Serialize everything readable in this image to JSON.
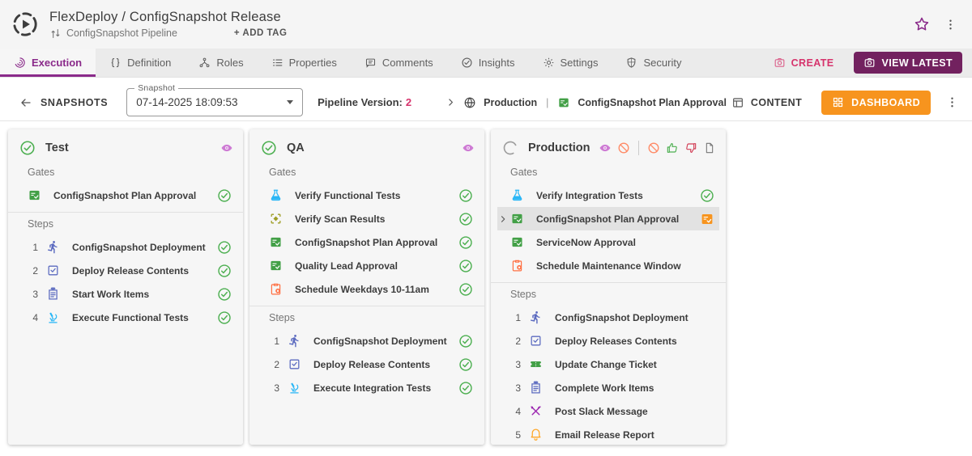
{
  "header": {
    "title": "FlexDeploy / ConfigSnapshot Release",
    "pipeline_label": "ConfigSnapshot Pipeline",
    "add_tag_label": "+ ADD TAG"
  },
  "tabs": [
    {
      "label": "Execution",
      "icon": "execution",
      "active": true
    },
    {
      "label": "Definition",
      "icon": "braces",
      "active": false
    },
    {
      "label": "Roles",
      "icon": "roles",
      "active": false
    },
    {
      "label": "Properties",
      "icon": "properties",
      "active": false
    },
    {
      "label": "Comments",
      "icon": "comments",
      "active": false
    },
    {
      "label": "Insights",
      "icon": "insights",
      "active": false
    },
    {
      "label": "Settings",
      "icon": "gear",
      "active": false
    },
    {
      "label": "Security",
      "icon": "shield",
      "active": false
    }
  ],
  "actions": {
    "create_label": "CREATE",
    "view_latest_label": "VIEW LATEST"
  },
  "snapshot_bar": {
    "back_label": "SNAPSHOTS",
    "select_label": "Snapshot",
    "select_value": "07-14-2025 18:09:53",
    "pipeline_version_label": "Pipeline Version:",
    "pipeline_version_value": "2",
    "env_name": "Production",
    "separator": "|",
    "gate_name": "ConfigSnapshot Plan Approval",
    "content_label": "CONTENT",
    "dashboard_label": "DASHBOARD"
  },
  "section_labels": {
    "gates": "Gates",
    "steps": "Steps"
  },
  "columns": [
    {
      "name": "Test",
      "status": "success",
      "header_icons": [
        "eye"
      ],
      "gates": [
        {
          "icon": "approval",
          "label": "ConfigSnapshot Plan Approval",
          "status": "success"
        }
      ],
      "steps": [
        {
          "num": "1",
          "icon": "run",
          "label": "ConfigSnapshot Deployment",
          "status": "success"
        },
        {
          "num": "2",
          "icon": "deploy",
          "label": "Deploy Release Contents",
          "status": "success"
        },
        {
          "num": "3",
          "icon": "workitem",
          "label": "Start Work Items",
          "status": "success"
        },
        {
          "num": "4",
          "icon": "microscope",
          "label": "Execute Functional Tests",
          "status": "success"
        }
      ]
    },
    {
      "name": "QA",
      "status": "success",
      "header_icons": [
        "eye"
      ],
      "gates": [
        {
          "icon": "flask",
          "label": "Verify Functional Tests",
          "status": "success"
        },
        {
          "icon": "scan",
          "label": "Verify Scan Results",
          "status": "success"
        },
        {
          "icon": "approval",
          "label": "ConfigSnapshot Plan Approval",
          "status": "success"
        },
        {
          "icon": "approval",
          "label": "Quality Lead Approval",
          "status": "success"
        },
        {
          "icon": "schedule",
          "label": "Schedule Weekdays 10-11am",
          "status": "success"
        }
      ],
      "steps": [
        {
          "num": "1",
          "icon": "run",
          "label": "ConfigSnapshot Deployment",
          "status": "success"
        },
        {
          "num": "2",
          "icon": "deploy",
          "label": "Deploy Release Contents",
          "status": "success"
        },
        {
          "num": "3",
          "icon": "microscope",
          "label": "Execute Integration Tests",
          "status": "success"
        }
      ]
    },
    {
      "name": "Production",
      "status": "running",
      "header_icons": [
        "eye",
        "block",
        "divider",
        "block",
        "thumb-up",
        "thumb-down",
        "doc"
      ],
      "gates": [
        {
          "icon": "flask",
          "label": "Verify Integration Tests",
          "status": "success"
        },
        {
          "icon": "approval",
          "label": "ConfigSnapshot Plan Approval",
          "status": "pending",
          "selected": true
        },
        {
          "icon": "approval",
          "label": "ServiceNow Approval",
          "status": "none"
        },
        {
          "icon": "schedule",
          "label": "Schedule Maintenance Window",
          "status": "none"
        }
      ],
      "steps": [
        {
          "num": "1",
          "icon": "run",
          "label": "ConfigSnapshot Deployment",
          "status": "none"
        },
        {
          "num": "2",
          "icon": "deploy",
          "label": "Deploy Releases Contents",
          "status": "none"
        },
        {
          "num": "3",
          "icon": "ticket",
          "label": "Update Change Ticket",
          "status": "none"
        },
        {
          "num": "3",
          "icon": "workitem",
          "label": "Complete Work Items",
          "status": "none"
        },
        {
          "num": "4",
          "icon": "tools",
          "label": "Post Slack Message",
          "status": "none"
        },
        {
          "num": "5",
          "icon": "bell",
          "label": "Email Release Report",
          "status": "none"
        }
      ]
    }
  ],
  "colors": {
    "accent_purple": "#8a2a8a",
    "view_latest_purple": "#72215f",
    "create_pink": "#d6336c",
    "dashboard_orange": "#f7941e",
    "success_green": "#4caf50",
    "pending_orange": "#f7941e",
    "running_gray": "#9e9e9e",
    "selected_row_bg": "#e2e2e2",
    "approval_green": "#43a047",
    "icons": {
      "run": "#5c6bc0",
      "deploy": "#5c6bc0",
      "workitem": "#5c6bc0",
      "microscope": "#29b6f6",
      "flask": "#29b6f6",
      "scan": "#9e9d24",
      "approval": "#43a047",
      "schedule": "#ff7043",
      "ticket": "#43a047",
      "tools": "#9c27b0",
      "bell": "#ffa726",
      "eye": "#ce7bd4",
      "block": "#ff8a65",
      "thumb-up": "#4caf50",
      "thumb-down": "#d23f57",
      "doc": "#757575"
    }
  }
}
